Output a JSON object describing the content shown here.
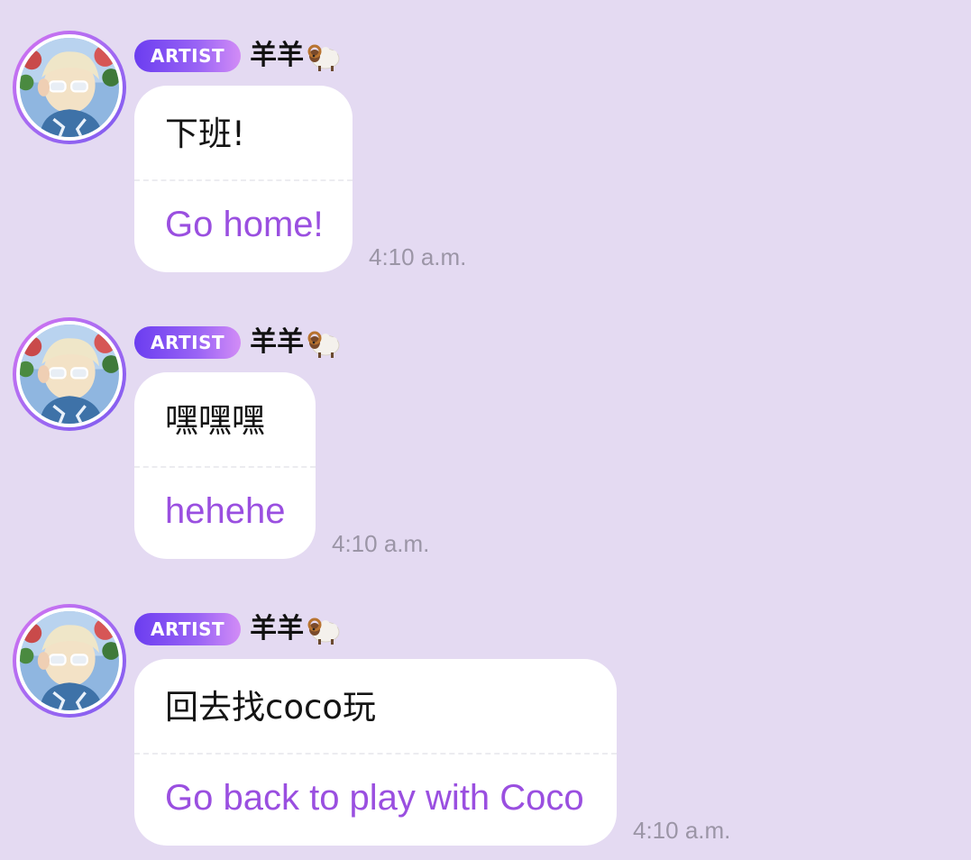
{
  "messages": [
    {
      "badge": "ARTIST",
      "sender": "羊羊",
      "original": "下班!",
      "translation": "Go home!",
      "time": "4:10 a.m."
    },
    {
      "badge": "ARTIST",
      "sender": "羊羊",
      "original": "嘿嘿嘿",
      "translation": "hehehe",
      "time": "4:10 a.m."
    },
    {
      "badge": "ARTIST",
      "sender": "羊羊",
      "original": "回去找coco玩",
      "translation": "Go back to play with Coco",
      "time": "4:10 a.m."
    }
  ],
  "icons": {
    "sender_emoji": "ram-icon"
  },
  "colors": {
    "background": "#e4daf2",
    "bubble": "#ffffff",
    "translation_text": "#9a4fe0",
    "timestamp": "#9b95a6",
    "badge_start": "#6b3df0",
    "badge_end": "#d28cf6"
  }
}
